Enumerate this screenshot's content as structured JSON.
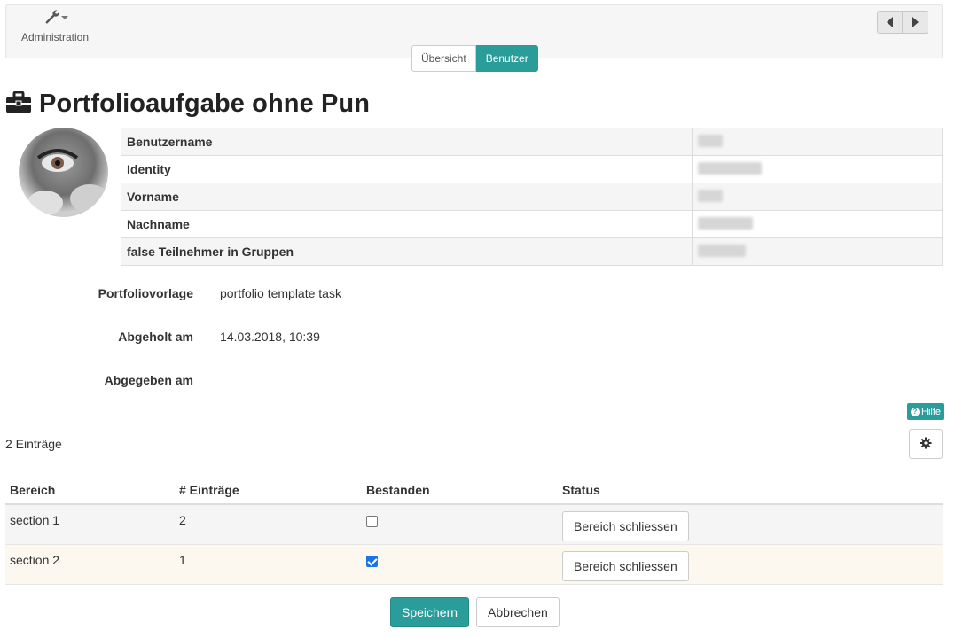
{
  "toolbar": {
    "admin_label": "Administration",
    "admin_icon": "wrench-icon",
    "prev_icon": "chevron-left-icon",
    "next_icon": "chevron-right-icon"
  },
  "tabs": [
    {
      "label": "Übersicht",
      "active": false
    },
    {
      "label": "Benutzer",
      "active": true
    }
  ],
  "page": {
    "title": "Portfolioaufgabe ohne Pun",
    "title_icon": "briefcase-icon"
  },
  "user_info": [
    {
      "label": "Benutzername",
      "value": ""
    },
    {
      "label": "Identity",
      "value": ""
    },
    {
      "label": "Vorname",
      "value": ""
    },
    {
      "label": "Nachname",
      "value": ""
    },
    {
      "label": "false Teilnehmer in Gruppen",
      "value": ""
    }
  ],
  "fields": [
    {
      "label": "Portfoliovorlage",
      "value": "portfolio template task"
    },
    {
      "label": "Abgeholt am",
      "value": "14.03.2018, 10:39"
    },
    {
      "label": "Abgegeben am",
      "value": ""
    }
  ],
  "help_label": "Hilfe",
  "entries_count": "2 Einträge",
  "table": {
    "headers": [
      "Bereich",
      "# Einträge",
      "Bestanden",
      "Status"
    ],
    "rows": [
      {
        "bereich": "section 1",
        "eintraege": "2",
        "bestanden": false,
        "status_button": "Bereich schliessen"
      },
      {
        "bereich": "section 2",
        "eintraege": "1",
        "bestanden": true,
        "status_button": "Bereich schliessen"
      }
    ]
  },
  "actions": {
    "save": "Speichern",
    "cancel": "Abbrechen"
  },
  "colors": {
    "accent": "#2a9d9b",
    "checkbox_checked": "#1a73e8"
  }
}
